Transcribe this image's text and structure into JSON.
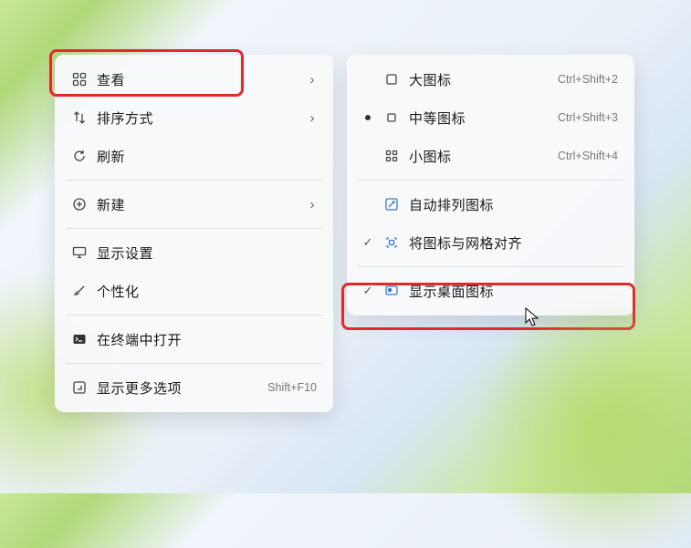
{
  "primary_menu": {
    "items": [
      {
        "label": "查看",
        "has_submenu": true
      },
      {
        "label": "排序方式",
        "has_submenu": true
      },
      {
        "label": "刷新"
      },
      {
        "label": "新建",
        "has_submenu": true
      },
      {
        "label": "显示设置"
      },
      {
        "label": "个性化"
      },
      {
        "label": "在终端中打开"
      },
      {
        "label": "显示更多选项",
        "accel": "Shift+F10"
      }
    ]
  },
  "secondary_menu": {
    "items": [
      {
        "label": "大图标",
        "accel": "Ctrl+Shift+2"
      },
      {
        "label": "中等图标",
        "accel": "Ctrl+Shift+3",
        "selected": true
      },
      {
        "label": "小图标",
        "accel": "Ctrl+Shift+4"
      },
      {
        "label": "自动排列图标"
      },
      {
        "label": "将图标与网格对齐",
        "checked": true
      },
      {
        "label": "显示桌面图标",
        "checked": true
      }
    ]
  },
  "chevron": "›",
  "check": "✓"
}
